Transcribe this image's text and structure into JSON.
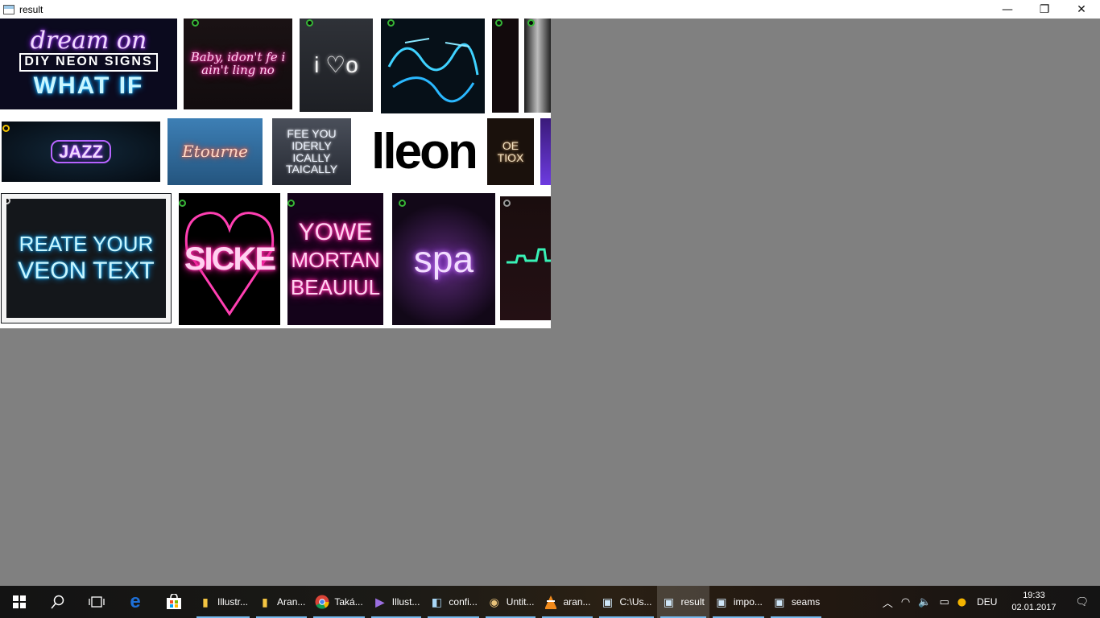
{
  "window": {
    "title": "result",
    "minimize_glyph": "—",
    "restore_glyph": "❐",
    "close_glyph": "✕"
  },
  "tiles": {
    "t1_line1": "dream on",
    "t1_line2": "DIY NEON SIGNS",
    "t1_line3": "WHAT IF",
    "t2": "Baby, idon't fe i ain't ling no",
    "t3": "i ♡o",
    "t5": "JAZZ",
    "t6": "Etourne",
    "t7": "FEE YOU IDERLY ICALLY TAICALLY",
    "t8": "lleon",
    "t9": "OE TIOX",
    "t10_line1": "REATE YOUR",
    "t10_line2": "VEON TEXT",
    "t11": "SICKE",
    "t12_line1": "YOWE",
    "t12_line2": "MORTAN",
    "t12_line3": "BEAUIUL",
    "t13": "spa"
  },
  "taskbar": {
    "start_icon": "windows-logo",
    "apps": [
      {
        "label": "Illustr..."
      },
      {
        "label": "Aran..."
      },
      {
        "label": "Taká..."
      },
      {
        "label": "Illust..."
      },
      {
        "label": "confi..."
      },
      {
        "label": "Untit..."
      },
      {
        "label": "aran..."
      },
      {
        "label": "C:\\Us..."
      },
      {
        "label": "result"
      },
      {
        "label": "impo..."
      },
      {
        "label": "seams"
      }
    ],
    "language": "DEU",
    "time": "19:33",
    "date": "02.01.2017"
  },
  "colors": {
    "background": "#808080",
    "taskbar_accent": "#76b9ed",
    "edge_blue": "#1e6fd6"
  }
}
